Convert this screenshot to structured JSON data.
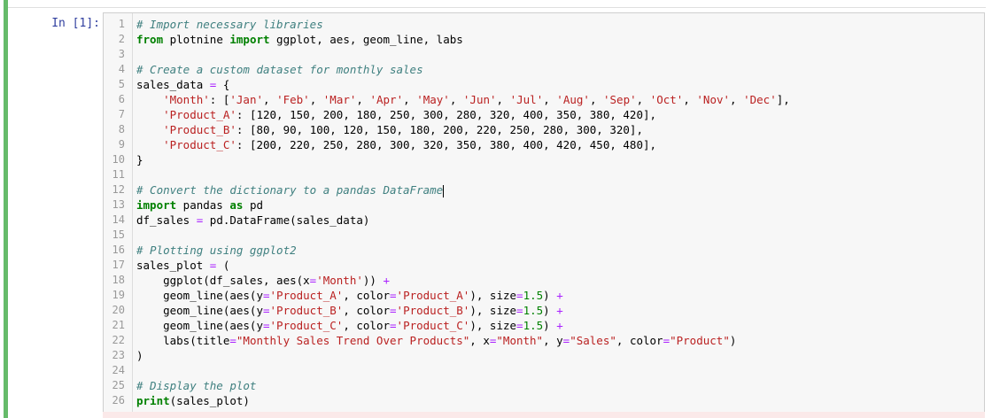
{
  "cell": {
    "prompt": "In [1]:",
    "lines": [
      {
        "n": "1",
        "tokens": [
          {
            "t": "cm",
            "v": "# Import necessary libraries"
          }
        ]
      },
      {
        "n": "2",
        "tokens": [
          {
            "t": "kw",
            "v": "from"
          },
          {
            "t": "",
            "v": " plotnine "
          },
          {
            "t": "kw",
            "v": "import"
          },
          {
            "t": "",
            "v": " ggplot, aes, geom_line, labs"
          }
        ]
      },
      {
        "n": "3",
        "tokens": []
      },
      {
        "n": "4",
        "tokens": [
          {
            "t": "cm",
            "v": "# Create a custom dataset for monthly sales"
          }
        ]
      },
      {
        "n": "5",
        "tokens": [
          {
            "t": "",
            "v": "sales_data "
          },
          {
            "t": "op",
            "v": "="
          },
          {
            "t": "",
            "v": " {"
          }
        ]
      },
      {
        "n": "6",
        "tokens": [
          {
            "t": "",
            "v": "    "
          },
          {
            "t": "st",
            "v": "'Month'"
          },
          {
            "t": "",
            "v": ": ["
          },
          {
            "t": "st",
            "v": "'Jan'"
          },
          {
            "t": "",
            "v": ", "
          },
          {
            "t": "st",
            "v": "'Feb'"
          },
          {
            "t": "",
            "v": ", "
          },
          {
            "t": "st",
            "v": "'Mar'"
          },
          {
            "t": "",
            "v": ", "
          },
          {
            "t": "st",
            "v": "'Apr'"
          },
          {
            "t": "",
            "v": ", "
          },
          {
            "t": "st",
            "v": "'May'"
          },
          {
            "t": "",
            "v": ", "
          },
          {
            "t": "st",
            "v": "'Jun'"
          },
          {
            "t": "",
            "v": ", "
          },
          {
            "t": "st",
            "v": "'Jul'"
          },
          {
            "t": "",
            "v": ", "
          },
          {
            "t": "st",
            "v": "'Aug'"
          },
          {
            "t": "",
            "v": ", "
          },
          {
            "t": "st",
            "v": "'Sep'"
          },
          {
            "t": "",
            "v": ", "
          },
          {
            "t": "st",
            "v": "'Oct'"
          },
          {
            "t": "",
            "v": ", "
          },
          {
            "t": "st",
            "v": "'Nov'"
          },
          {
            "t": "",
            "v": ", "
          },
          {
            "t": "st",
            "v": "'Dec'"
          },
          {
            "t": "",
            "v": "],"
          }
        ]
      },
      {
        "n": "7",
        "tokens": [
          {
            "t": "",
            "v": "    "
          },
          {
            "t": "st",
            "v": "'Product_A'"
          },
          {
            "t": "",
            "v": ": [120, 150, 200, 180, 250, 300, 280, 320, 400, 350, 380, 420],"
          }
        ]
      },
      {
        "n": "8",
        "tokens": [
          {
            "t": "",
            "v": "    "
          },
          {
            "t": "st",
            "v": "'Product_B'"
          },
          {
            "t": "",
            "v": ": [80, 90, 100, 120, 150, 180, 200, 220, 250, 280, 300, 320],"
          }
        ]
      },
      {
        "n": "9",
        "tokens": [
          {
            "t": "",
            "v": "    "
          },
          {
            "t": "st",
            "v": "'Product_C'"
          },
          {
            "t": "",
            "v": ": [200, 220, 250, 280, 300, 320, 350, 380, 400, 420, 450, 480],"
          }
        ]
      },
      {
        "n": "10",
        "tokens": [
          {
            "t": "",
            "v": "}"
          }
        ]
      },
      {
        "n": "11",
        "tokens": []
      },
      {
        "n": "12",
        "tokens": [
          {
            "t": "cm",
            "v": "# Convert the dictionary to a pandas DataFrame"
          },
          {
            "t": "cursor",
            "v": ""
          }
        ]
      },
      {
        "n": "13",
        "tokens": [
          {
            "t": "kw",
            "v": "import"
          },
          {
            "t": "",
            "v": " pandas "
          },
          {
            "t": "kw",
            "v": "as"
          },
          {
            "t": "",
            "v": " pd"
          }
        ]
      },
      {
        "n": "14",
        "tokens": [
          {
            "t": "",
            "v": "df_sales "
          },
          {
            "t": "op",
            "v": "="
          },
          {
            "t": "",
            "v": " pd.DataFrame(sales_data)"
          }
        ]
      },
      {
        "n": "15",
        "tokens": []
      },
      {
        "n": "16",
        "tokens": [
          {
            "t": "cm",
            "v": "# Plotting using ggplot2"
          }
        ]
      },
      {
        "n": "17",
        "tokens": [
          {
            "t": "",
            "v": "sales_plot "
          },
          {
            "t": "op",
            "v": "="
          },
          {
            "t": "",
            "v": " ("
          }
        ]
      },
      {
        "n": "18",
        "tokens": [
          {
            "t": "",
            "v": "    ggplot(df_sales, aes(x"
          },
          {
            "t": "op",
            "v": "="
          },
          {
            "t": "st",
            "v": "'Month'"
          },
          {
            "t": "",
            "v": ")) "
          },
          {
            "t": "op",
            "v": "+"
          }
        ]
      },
      {
        "n": "19",
        "tokens": [
          {
            "t": "",
            "v": "    geom_line(aes(y"
          },
          {
            "t": "op",
            "v": "="
          },
          {
            "t": "st",
            "v": "'Product_A'"
          },
          {
            "t": "",
            "v": ", color"
          },
          {
            "t": "op",
            "v": "="
          },
          {
            "t": "st",
            "v": "'Product_A'"
          },
          {
            "t": "",
            "v": "), size"
          },
          {
            "t": "op",
            "v": "="
          },
          {
            "t": "nu",
            "v": "1.5"
          },
          {
            "t": "",
            "v": ") "
          },
          {
            "t": "op",
            "v": "+"
          }
        ]
      },
      {
        "n": "20",
        "tokens": [
          {
            "t": "",
            "v": "    geom_line(aes(y"
          },
          {
            "t": "op",
            "v": "="
          },
          {
            "t": "st",
            "v": "'Product_B'"
          },
          {
            "t": "",
            "v": ", color"
          },
          {
            "t": "op",
            "v": "="
          },
          {
            "t": "st",
            "v": "'Product_B'"
          },
          {
            "t": "",
            "v": "), size"
          },
          {
            "t": "op",
            "v": "="
          },
          {
            "t": "nu",
            "v": "1.5"
          },
          {
            "t": "",
            "v": ") "
          },
          {
            "t": "op",
            "v": "+"
          }
        ]
      },
      {
        "n": "21",
        "tokens": [
          {
            "t": "",
            "v": "    geom_line(aes(y"
          },
          {
            "t": "op",
            "v": "="
          },
          {
            "t": "st",
            "v": "'Product_C'"
          },
          {
            "t": "",
            "v": ", color"
          },
          {
            "t": "op",
            "v": "="
          },
          {
            "t": "st",
            "v": "'Product_C'"
          },
          {
            "t": "",
            "v": "), size"
          },
          {
            "t": "op",
            "v": "="
          },
          {
            "t": "nu",
            "v": "1.5"
          },
          {
            "t": "",
            "v": ") "
          },
          {
            "t": "op",
            "v": "+"
          }
        ]
      },
      {
        "n": "22",
        "tokens": [
          {
            "t": "",
            "v": "    labs(title"
          },
          {
            "t": "op",
            "v": "="
          },
          {
            "t": "st",
            "v": "\"Monthly Sales Trend Over Products\""
          },
          {
            "t": "",
            "v": ", x"
          },
          {
            "t": "op",
            "v": "="
          },
          {
            "t": "st",
            "v": "\"Month\""
          },
          {
            "t": "",
            "v": ", y"
          },
          {
            "t": "op",
            "v": "="
          },
          {
            "t": "st",
            "v": "\"Sales\""
          },
          {
            "t": "",
            "v": ", color"
          },
          {
            "t": "op",
            "v": "="
          },
          {
            "t": "st",
            "v": "\"Product\""
          },
          {
            "t": "",
            "v": ")"
          }
        ]
      },
      {
        "n": "23",
        "tokens": [
          {
            "t": "",
            "v": ")"
          }
        ]
      },
      {
        "n": "24",
        "tokens": []
      },
      {
        "n": "25",
        "tokens": [
          {
            "t": "cm",
            "v": "# Display the plot"
          }
        ]
      },
      {
        "n": "26",
        "tokens": [
          {
            "t": "kw",
            "v": "print"
          },
          {
            "t": "",
            "v": "(sales_plot)"
          }
        ]
      }
    ]
  },
  "colors": {
    "cell_border_active": "#66bb6a",
    "prompt": "#303f9f",
    "comment": "#408080",
    "keyword": "#008000",
    "string": "#ba2121",
    "operator": "#aa22ff",
    "number": "#008000"
  }
}
